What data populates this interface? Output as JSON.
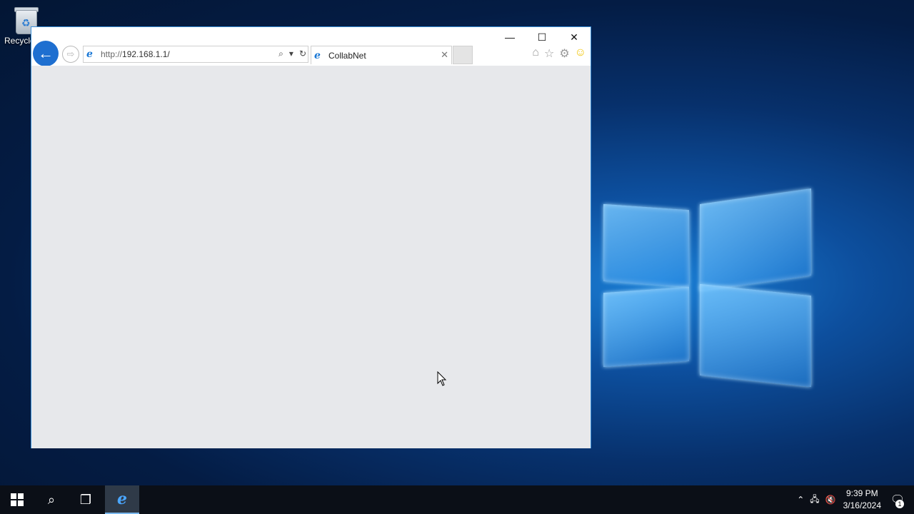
{
  "desktop": {
    "recycle_bin_label": "Recycle Bin"
  },
  "browser": {
    "address": {
      "protocol": "http://",
      "host": "192.168.1.1/"
    },
    "tab_title": "CollabNet",
    "window_controls": {
      "minimize": "—",
      "maximize": "☐",
      "close": "✕"
    },
    "icons": [
      "back-icon",
      "forward-icon",
      "search-icon",
      "refresh-icon",
      "home-icon",
      "favorites-star-icon",
      "settings-gear-icon",
      "feedback-smiley-icon"
    ]
  },
  "taskbar": {
    "time": "9:39 PM",
    "date": "3/16/2024",
    "notification_count": "1"
  },
  "colors": {
    "accent": "#1e6fd0",
    "taskbar": "#0b0f17",
    "content_bg": "#e7e8eb"
  }
}
